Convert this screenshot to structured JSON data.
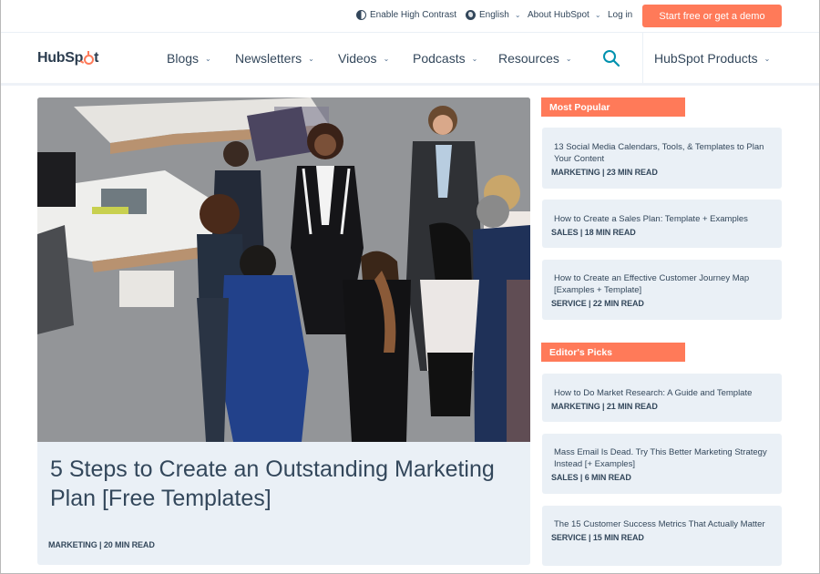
{
  "utility_bar": {
    "high_contrast": "Enable High Contrast",
    "language": "English",
    "about": "About HubSpot",
    "login": "Log in",
    "cta": "Start free or get a demo"
  },
  "nav": {
    "logo": {
      "text_before": "HubSp",
      "text_after": "t"
    },
    "items": [
      {
        "label": "Blogs"
      },
      {
        "label": "Newsletters"
      },
      {
        "label": "Videos"
      },
      {
        "label": "Podcasts"
      },
      {
        "label": "Resources"
      }
    ],
    "products": "HubSpot Products",
    "chevron": "⌄"
  },
  "hero": {
    "title": "5 Steps to Create an Outstanding Marketing Plan [Free Templates]",
    "meta": "MARKETING | 20 MIN READ",
    "image_alt": "Business team meeting standing in an office"
  },
  "sidebar": {
    "most_popular": {
      "label": "Most Popular",
      "items": [
        {
          "title": "13 Social Media Calendars, Tools, & Templates to Plan Your Content",
          "meta": "MARKETING | 23 MIN READ"
        },
        {
          "title": "How to Create a Sales Plan: Template + Examples",
          "meta": "SALES | 18 MIN READ"
        },
        {
          "title": "How to Create an Effective Customer Journey Map [Examples + Template]",
          "meta": "SERVICE | 22 MIN READ"
        }
      ]
    },
    "editors_picks": {
      "label": "Editor's Picks",
      "items": [
        {
          "title": "How to Do Market Research: A Guide and Template",
          "meta": "MARKETING | 21 MIN READ"
        },
        {
          "title": "Mass Email Is Dead. Try This Better Marketing Strategy Instead [+ Examples]",
          "meta": "SALES | 6 MIN READ"
        },
        {
          "title": "The 15 Customer Success Metrics That Actually Matter",
          "meta": "SERVICE | 15 MIN READ"
        }
      ]
    }
  },
  "colors": {
    "accent": "#ff7a59",
    "text": "#33475b",
    "card_bg": "#eaf0f6",
    "search_icon": "#0091ae"
  }
}
